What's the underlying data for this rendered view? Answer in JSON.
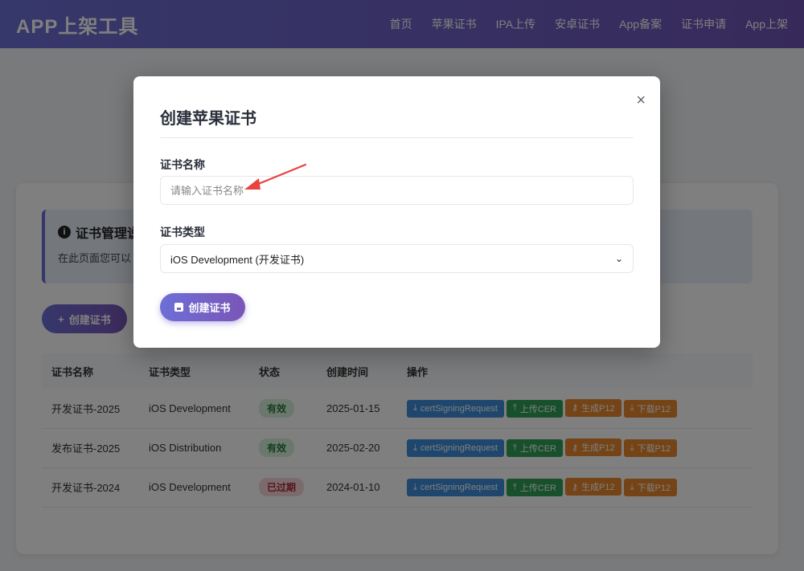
{
  "header": {
    "brand": "APP上架工具",
    "nav": [
      "首页",
      "苹果证书",
      "IPA上传",
      "安卓证书",
      "App备案",
      "证书申请",
      "App上架"
    ]
  },
  "page": {
    "info_title": "证书管理说",
    "info_text": "在此页面您可以",
    "create_button": "创建证书",
    "table": {
      "headers": [
        "证书名称",
        "证书类型",
        "状态",
        "创建时间",
        "操作"
      ],
      "rows": [
        {
          "name": "开发证书-2025",
          "type": "iOS Development",
          "status": "有效",
          "status_kind": "ok",
          "date": "2025-01-15"
        },
        {
          "name": "发布证书-2025",
          "type": "iOS Distribution",
          "status": "有效",
          "status_kind": "ok",
          "date": "2025-02-20"
        },
        {
          "name": "开发证书-2024",
          "type": "iOS Development",
          "status": "已过期",
          "status_kind": "expired",
          "date": "2024-01-10"
        }
      ],
      "actions": [
        "certSigningRequest",
        "上传CER",
        "生成P12",
        "下载P12"
      ]
    }
  },
  "modal": {
    "title": "创建苹果证书",
    "close": "×",
    "name_label": "证书名称",
    "name_placeholder": "请输入证书名称",
    "type_label": "证书类型",
    "type_selected": "iOS Development (开发证书)",
    "submit_label": "创建证书"
  },
  "colors": {
    "header_gradient_start": "#6d6fd6",
    "header_gradient_end": "#6f55b6",
    "action_blue": "#3f8edc",
    "action_green": "#2fa057",
    "action_orange": "#e8892f",
    "annotation_arrow": "#e8433f"
  }
}
